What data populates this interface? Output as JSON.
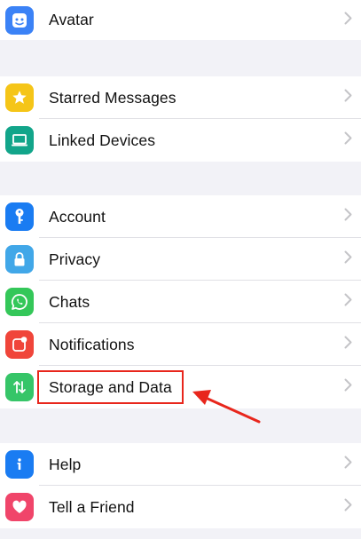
{
  "settings": {
    "group1": [
      {
        "label": "Avatar",
        "icon": "avatar-icon",
        "color": "#3b82f6"
      }
    ],
    "group2": [
      {
        "label": "Starred Messages",
        "icon": "star-icon",
        "color": "#f5c518"
      },
      {
        "label": "Linked Devices",
        "icon": "laptop-icon",
        "color": "#12a58a"
      }
    ],
    "group3": [
      {
        "label": "Account",
        "icon": "key-icon",
        "color": "#1a7cf2"
      },
      {
        "label": "Privacy",
        "icon": "lock-icon",
        "color": "#41a7e8"
      },
      {
        "label": "Chats",
        "icon": "whatsapp-icon",
        "color": "#34c759"
      },
      {
        "label": "Notifications",
        "icon": "notification-icon",
        "color": "#f0453a"
      },
      {
        "label": "Storage and Data",
        "icon": "storage-arrows-icon",
        "color": "#36c568"
      }
    ],
    "group4": [
      {
        "label": "Help",
        "icon": "info-icon",
        "color": "#1a7cf2"
      },
      {
        "label": "Tell a Friend",
        "icon": "heart-icon",
        "color": "#f0456a"
      }
    ]
  },
  "annotation": {
    "highlight_color": "#e8261c",
    "highlighted_item": "Storage and Data"
  },
  "colors": {
    "background": "#f2f2f7",
    "row_background": "#ffffff",
    "chevron": "#c4c4c7"
  }
}
